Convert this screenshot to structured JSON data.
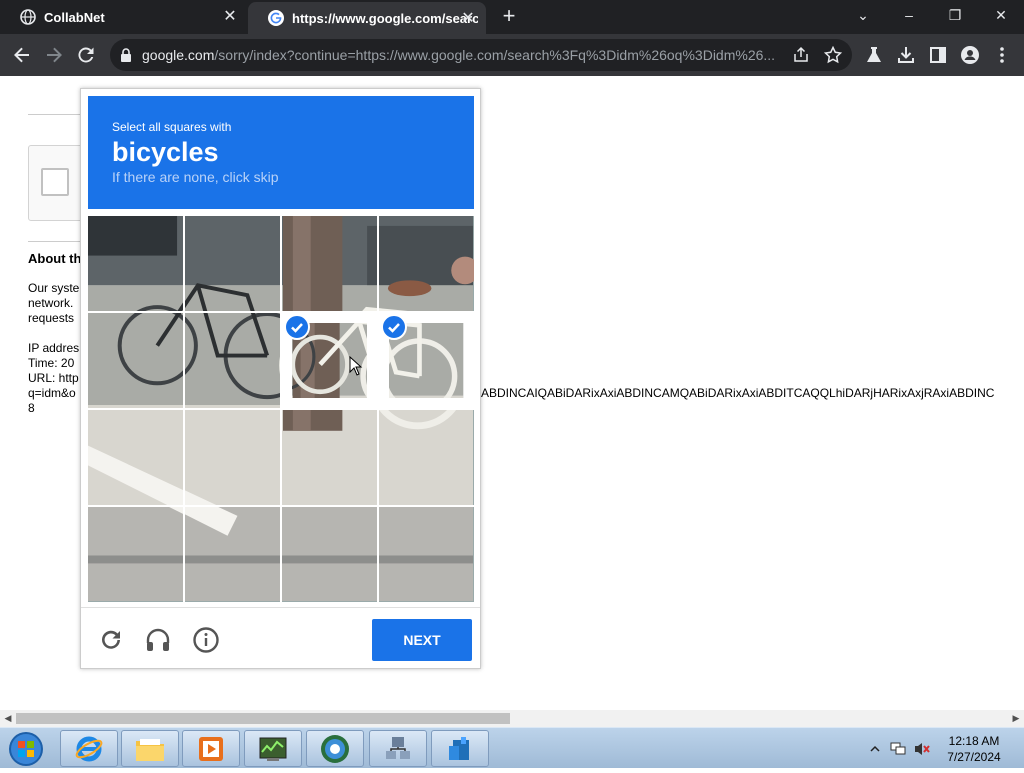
{
  "browser": {
    "tabs": [
      {
        "title": "CollabNet",
        "icon": "globe-icon"
      },
      {
        "title": "https://www.google.com/search?",
        "icon": "google-icon"
      }
    ],
    "new_tab": "+",
    "window_controls": {
      "minimize": "–",
      "restore": "❐",
      "close": "✕",
      "tab_search": "⌄"
    },
    "address": {
      "host": "google.com",
      "path": "/sorry/index?continue=https://www.google.com/search%3Fq%3Didm%26oq%3Didm%26..."
    }
  },
  "page": {
    "about_heading": "About th",
    "paragraph_lines": [
      "Our syste",
      "network.",
      "requests"
    ],
    "ip_label": "IP addres",
    "time_label": "Time: 20",
    "url_label": "URL: http",
    "query_line": "q=idm&o",
    "overflow_text": "ABDINCAIQABiDARixAxiABDINCAMQABiDARixAxiABDITCAQQLhiDARjHARixAxjRAxiABDINC",
    "line_8": "8"
  },
  "challenge": {
    "instruction_prefix": "Select all squares with",
    "target_object": "bicycles",
    "skip_hint": "If there are none, click skip",
    "tiles_selected": [
      6,
      7
    ],
    "next_label": "NEXT",
    "footer_icons": [
      "reload-icon",
      "audio-headphones-icon",
      "info-icon"
    ],
    "colors": {
      "accent": "#1a73e8"
    }
  },
  "taskbar": {
    "time": "12:18 AM",
    "date": "7/27/2024",
    "apps": [
      "internet-explorer-icon",
      "file-explorer-icon",
      "media-player-icon",
      "task-manager-icon",
      "browser-globe-icon",
      "network-icon",
      "server-icon"
    ]
  }
}
